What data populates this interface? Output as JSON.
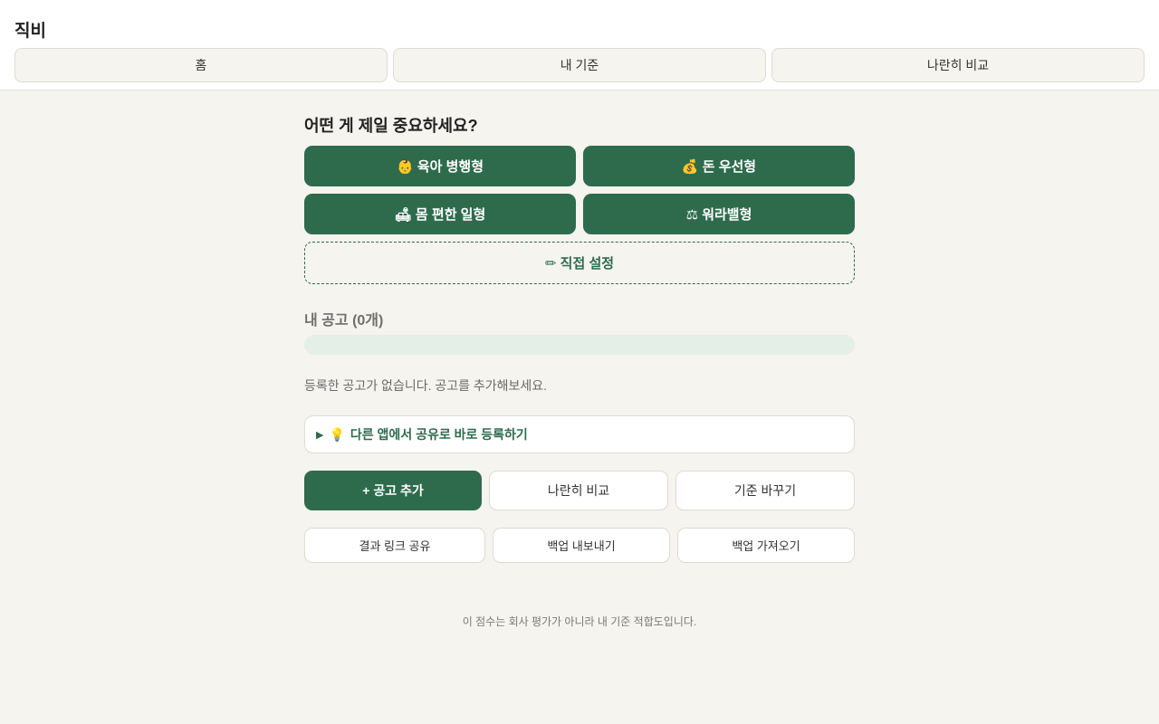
{
  "header": {
    "title": "직비",
    "tabs": [
      {
        "label": "홈"
      },
      {
        "label": "내 기준"
      },
      {
        "label": "나란히 비교"
      }
    ]
  },
  "priorities": {
    "heading": "어떤 게 제일 중요하세요?",
    "presets": [
      {
        "label": "👶 육아 병행형"
      },
      {
        "label": "💰 돈 우선형"
      },
      {
        "label": "🛋 몸 편한 일형"
      },
      {
        "label": "⚖ 워라밸형"
      }
    ],
    "custom_label": "✏ 직접 설정"
  },
  "postings": {
    "heading": "내 공고",
    "count_label": "(0개)",
    "progress": 0,
    "empty_message": "등록한 공고가 없습니다. 공고를 추가해보세요.",
    "share_tip": "다른 앱에서 공유로 바로 등록하기",
    "share_tip_icon": "lightbulb-icon",
    "disclosure_icon": "triangle-right-icon"
  },
  "actions": {
    "add_posting": "+ 공고 추가",
    "compare": "나란히 비교",
    "change_criteria": "기준 바꾸기",
    "share_link": "결과 링크 공유",
    "export_backup": "백업 내보내기",
    "import_backup": "백업 가져오기"
  },
  "footer": {
    "note": "이 점수는 회사 평가가 아니라 내 기준 적합도입니다."
  },
  "colors": {
    "accent": "#2e6b4d",
    "background": "#f5f4ef",
    "progress_track": "#e4efe7"
  }
}
